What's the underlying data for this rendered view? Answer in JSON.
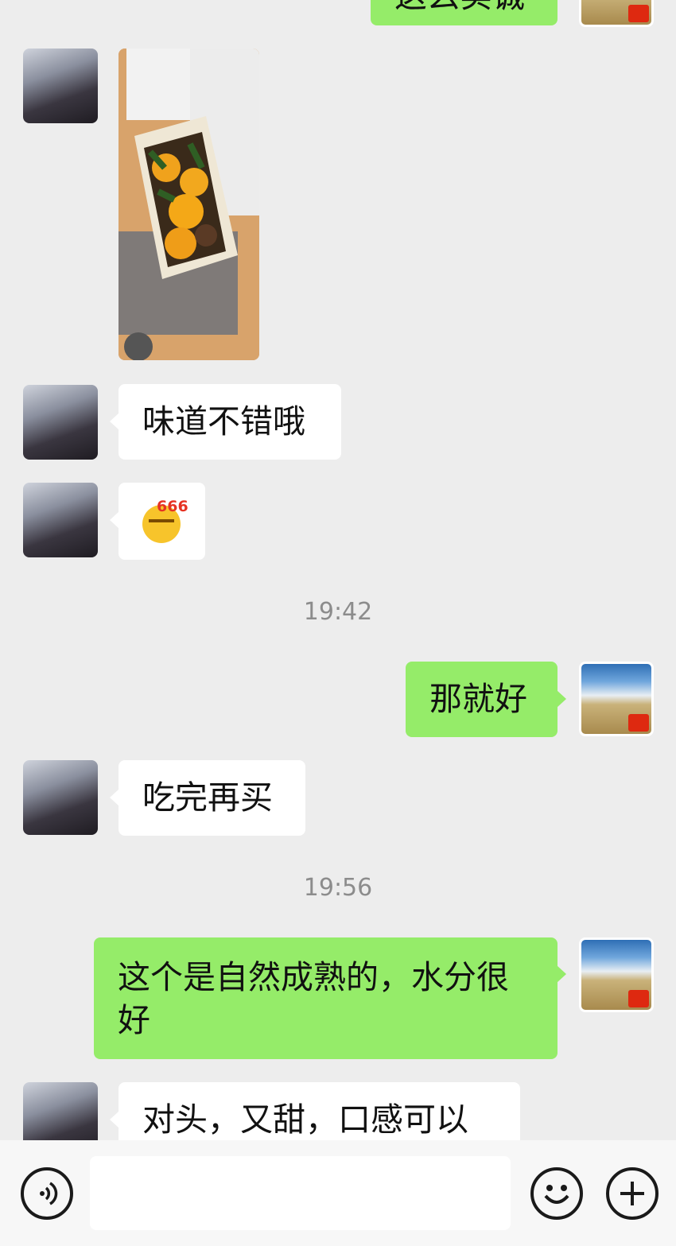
{
  "messages": {
    "m0_text": "这么实诚",
    "m2_text": "味道不错哦",
    "m3_emoji": "666",
    "time1": "19:42",
    "m4_text": "那就好",
    "m5_text": "吃完再买",
    "time2": "19:56",
    "m6_text": "这个是自然成熟的，水分很好",
    "m7_text": "对头，又甜，口感可以"
  },
  "icons": {
    "voice": "voice-icon",
    "emoji": "emoji-icon",
    "plus": "plus-icon"
  },
  "colors": {
    "background": "#ededed",
    "bubble_self": "#95ec69",
    "bubble_other": "#ffffff",
    "timestamp": "#8c8c8c"
  }
}
